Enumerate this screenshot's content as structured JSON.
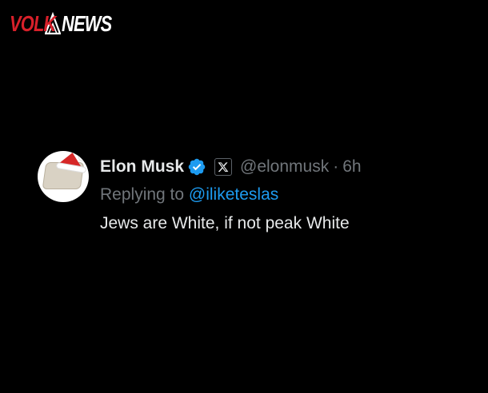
{
  "watermark": {
    "part1": "VOLK",
    "part2": "NEWS",
    "part1_color": "#d8202a",
    "part2_color": "#ffffff"
  },
  "tweet": {
    "author_name": "Elon Musk",
    "verified_icon": "verified-badge-icon",
    "affiliate_icon": "x-logo-icon",
    "handle": "@elonmusk",
    "separator": "·",
    "time": "6h",
    "replying_prefix": "Replying to ",
    "replying_to": "@iliketeslas",
    "text": "Jews are White, if not peak White",
    "colors": {
      "name": "#e7e9ea",
      "muted": "#71767b",
      "link": "#1d9bf0",
      "verified": "#1d9bf0",
      "background": "#000000"
    }
  }
}
